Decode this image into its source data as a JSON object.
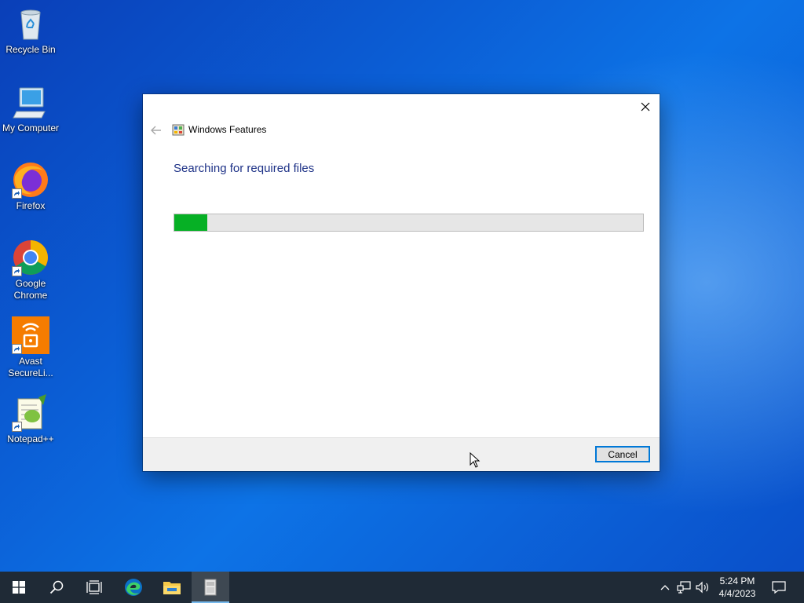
{
  "desktop": {
    "icons": [
      {
        "label": "Recycle Bin"
      },
      {
        "label": "My Computer"
      },
      {
        "label": "Firefox"
      },
      {
        "label": "Google Chrome"
      },
      {
        "label": "Avast SecureLi..."
      },
      {
        "label": "Notepad++"
      }
    ]
  },
  "dialog": {
    "title": "Windows Features",
    "heading": "Searching for required files",
    "progress": 0.07,
    "progress_color": "#06b025",
    "cancel_label": "Cancel"
  },
  "taskbar": {
    "pinned": [
      "start-icon",
      "search-icon",
      "task-view-icon",
      "edge-icon",
      "file-explorer-icon",
      "windows-features-icon"
    ],
    "clock": {
      "time": "5:24 PM",
      "date": "4/4/2023"
    }
  }
}
